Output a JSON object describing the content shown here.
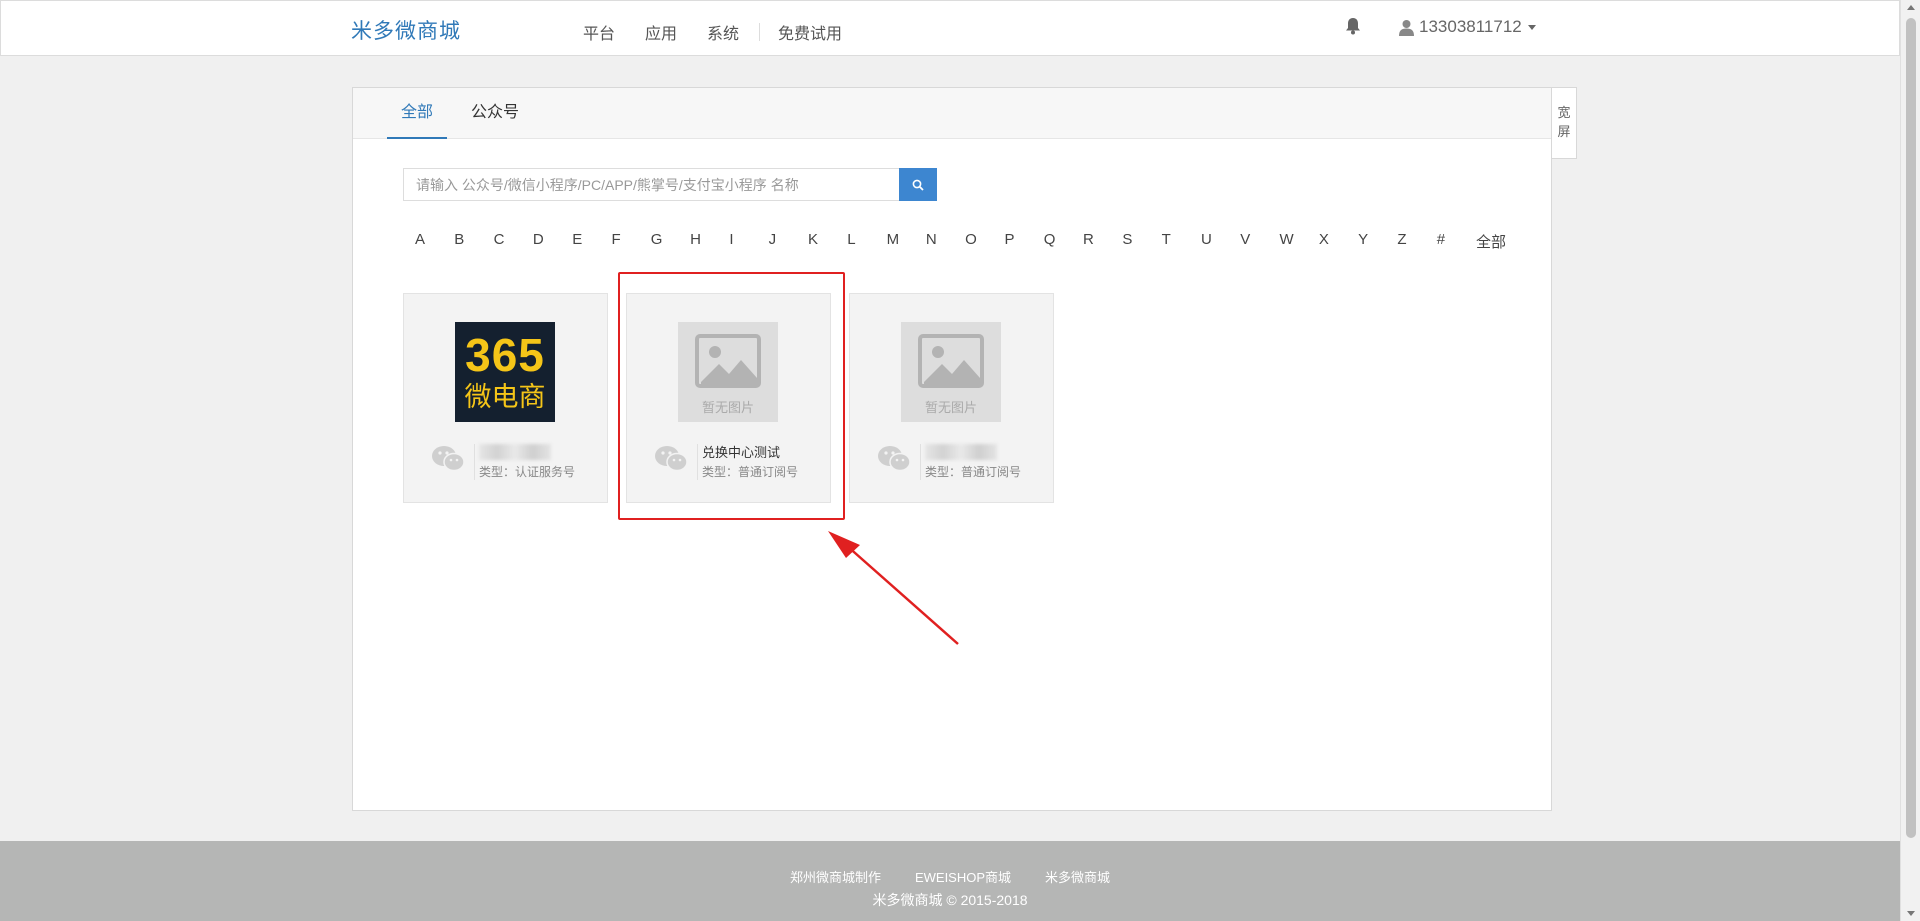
{
  "navbar": {
    "brand": "米多微商城",
    "links": [
      "平台",
      "应用",
      "系统"
    ],
    "trial": "免费试用",
    "user": "13303811712"
  },
  "panel": {
    "tabs": [
      {
        "label": "全部",
        "active": true
      },
      {
        "label": "公众号",
        "active": false
      }
    ],
    "wide_toggle": "宽屏",
    "search": {
      "placeholder": "请输入 公众号/微信小程序/PC/APP/熊掌号/支付宝小程序 名称"
    },
    "alphabet": [
      "A",
      "B",
      "C",
      "D",
      "E",
      "F",
      "G",
      "H",
      "I",
      "J",
      "K",
      "L",
      "M",
      "N",
      "O",
      "P",
      "Q",
      "R",
      "S",
      "T",
      "U",
      "V",
      "W",
      "X",
      "Y",
      "Z",
      "#",
      "全部"
    ],
    "accounts": [
      {
        "logo_num": "365",
        "logo_text": "微电商",
        "name": "",
        "type": "类型：认证服务号"
      },
      {
        "no_image": "暂无图片",
        "name": "兑换中心测试",
        "type": "类型：普通订阅号"
      },
      {
        "no_image": "暂无图片",
        "name": "",
        "type": "类型：普通订阅号"
      }
    ]
  },
  "footer": {
    "links": [
      "郑州微商城制作",
      "EWEISHOP商城",
      "米多微商城"
    ],
    "copyright": "米多微商城 © 2015-2018"
  },
  "colors": {
    "brand": "#3079b8",
    "search_button": "#3d86d0",
    "annotation": "#e02020",
    "footer_bg": "#b5b6b5"
  },
  "icons": [
    "bell-icon",
    "user-icon",
    "search-icon",
    "wechat-icon",
    "image-placeholder-icon"
  ]
}
